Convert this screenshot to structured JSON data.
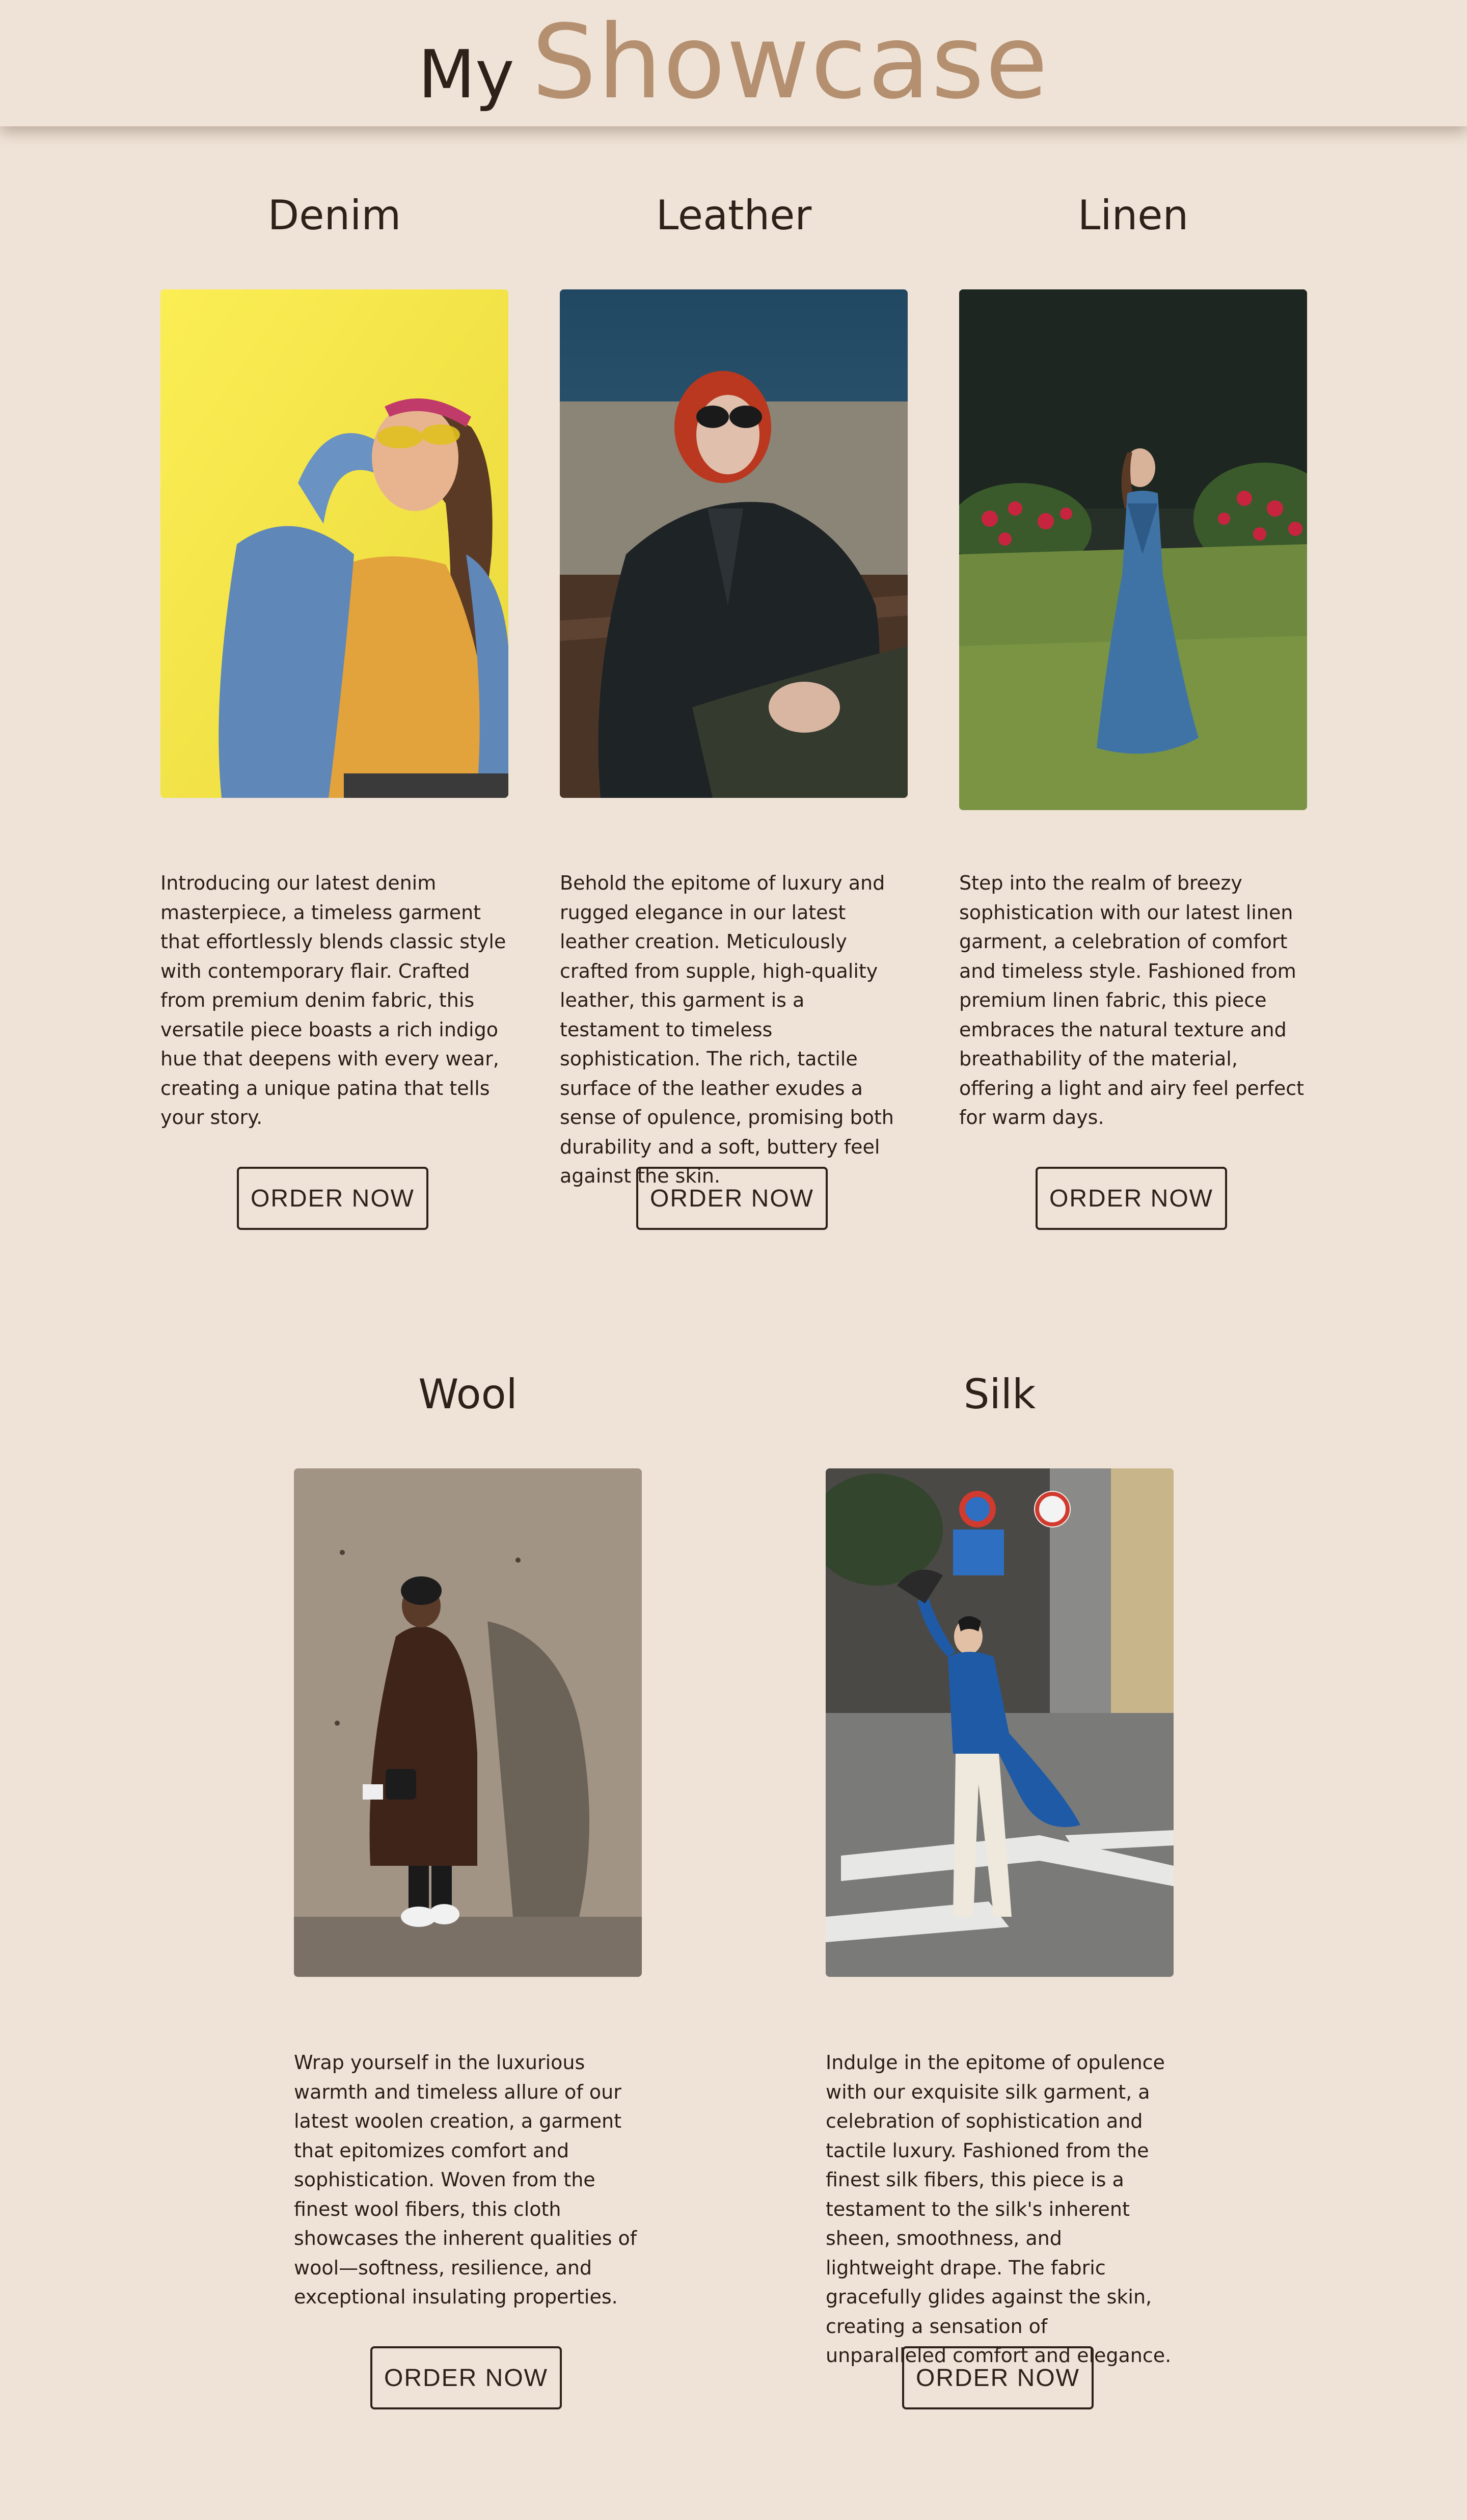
{
  "header": {
    "title_prefix": "My",
    "title_main": "Showcase"
  },
  "products": [
    {
      "name": "Denim",
      "image_alt": "woman-in-denim-jacket-photo",
      "description": "Introducing our latest denim masterpiece, a timeless garment that effortlessly blends classic style with contemporary flair. Crafted from premium denim fabric, this versatile piece boasts a rich indigo hue that deepens with every wear, creating a unique patina that tells your story.",
      "button_label": "ORDER NOW"
    },
    {
      "name": "Leather",
      "image_alt": "woman-in-leather-jacket-photo",
      "description": "Behold the epitome of luxury and rugged elegance in our latest leather creation. Meticulously crafted from supple, high-quality leather, this garment is a testament to timeless sophistication. The rich, tactile surface of the leather exudes a sense of opulence, promising both durability and a soft, buttery feel against the skin.",
      "button_label": "ORDER NOW"
    },
    {
      "name": "Linen",
      "image_alt": "woman-in-blue-linen-dress-photo",
      "description": "Step into the realm of breezy sophistication with our latest linen garment, a celebration of comfort and timeless style. Fashioned from premium linen fabric, this piece embraces the natural texture and breathability of the material, offering a light and airy feel perfect for warm days.",
      "button_label": "ORDER NOW"
    },
    {
      "name": "Wool",
      "image_alt": "man-in-wool-coat-photo",
      "description": "Wrap yourself in the luxurious warmth and timeless allure of our latest woolen creation, a garment that epitomizes comfort and sophistication. Woven from the finest wool fibers, this cloth showcases the inherent qualities of wool—softness, resilience, and exceptional insulating properties.",
      "button_label": "ORDER NOW"
    },
    {
      "name": "Silk",
      "image_alt": "woman-in-silk-ao-dai-photo",
      "description": "Indulge in the epitome of opulence with our exquisite silk garment, a celebration of sophistication and tactile luxury. Fashioned from the finest silk fibers, this piece is a testament to the silk's inherent sheen, smoothness, and lightweight drape. The fabric gracefully glides against the skin, creating a sensation of unparalleled comfort and elegance.",
      "button_label": "ORDER NOW"
    }
  ]
}
